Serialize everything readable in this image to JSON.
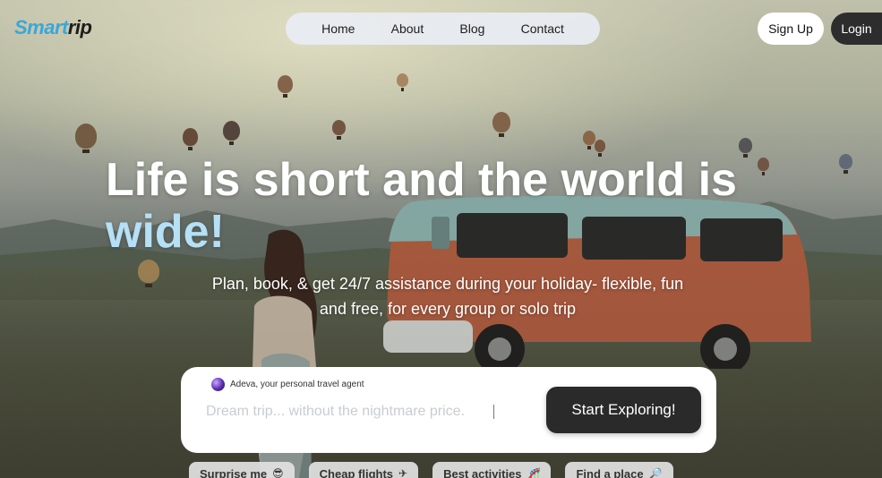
{
  "brand": {
    "logo_part1": "Smart",
    "logo_part2": "rip"
  },
  "nav": {
    "items": [
      "Home",
      "About",
      "Blog",
      "Contact"
    ]
  },
  "auth": {
    "signup_label": "Sign Up",
    "login_label": "Login"
  },
  "hero": {
    "headline_main": "Life is short and the world is",
    "headline_highlight": "wide!",
    "subtitle": "Plan, book, & get 24/7 assistance during your holiday- flexible, fun and free, for every group or solo trip"
  },
  "search": {
    "agent_label": "Adeva, your personal travel agent",
    "placeholder": "Dream trip... without the nightmare price.",
    "value": "",
    "cta_label": "Start Exploring!"
  },
  "quick_links": [
    {
      "label": "Surprise me",
      "icon": "sunglasses-face-icon",
      "glyph": "😎"
    },
    {
      "label": "Cheap flights",
      "icon": "airplane-icon",
      "glyph": "✈"
    },
    {
      "label": "Best activities",
      "icon": "activity-icon",
      "glyph": "🎢"
    },
    {
      "label": "Find a place",
      "icon": "magnifier-icon",
      "glyph": "🔎"
    }
  ],
  "colors": {
    "accent": "#3aa7d8",
    "headline_highlight": "#b5e0f6",
    "dark_button": "#2a2a2a"
  }
}
